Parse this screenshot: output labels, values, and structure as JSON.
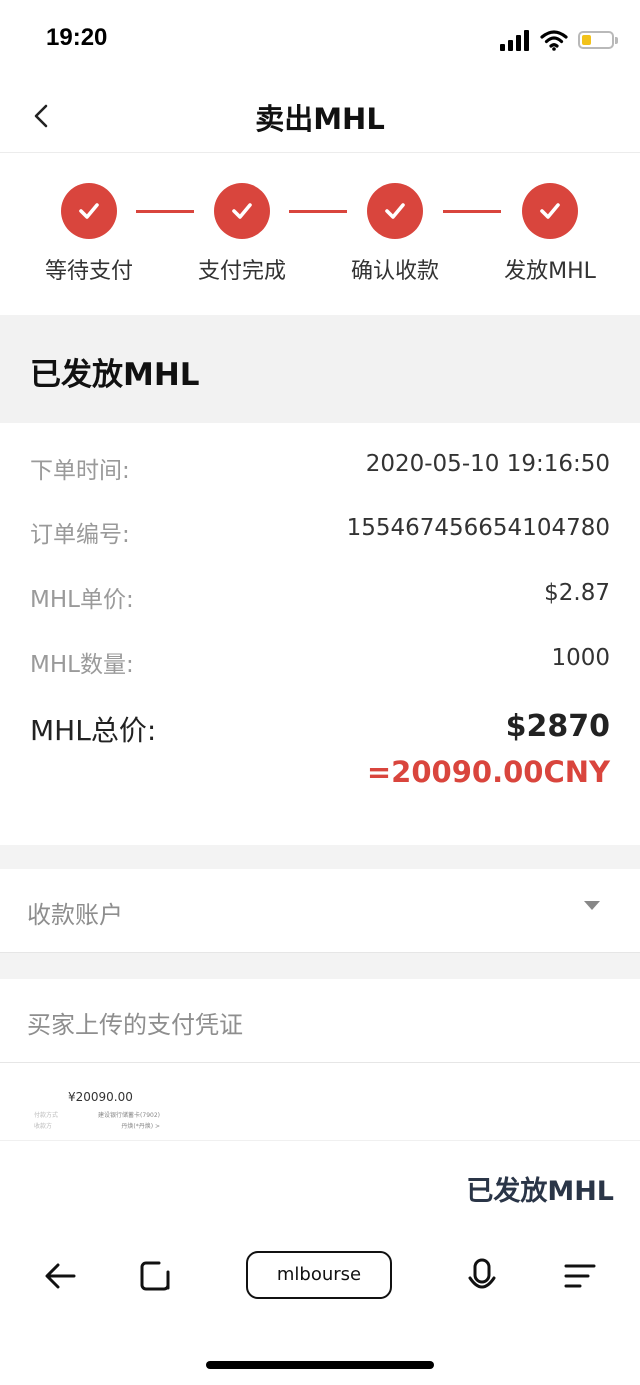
{
  "status_bar": {
    "time": "19:20",
    "battery_color": "#f2c21a"
  },
  "nav": {
    "title": "卖出MHL",
    "back_icon": "chevron-left-icon"
  },
  "steps": [
    {
      "label": "等待支付",
      "done": true
    },
    {
      "label": "支付完成",
      "done": true
    },
    {
      "label": "确认收款",
      "done": true
    },
    {
      "label": "发放MHL",
      "done": true
    }
  ],
  "status_title": "已发放MHL",
  "details": {
    "order_time": {
      "label": "下单时间:",
      "value": "2020-05-10 19:16:50"
    },
    "order_no": {
      "label": "订单编号:",
      "value": "155467456654104780"
    },
    "unit_price": {
      "label": "MHL单价:",
      "value": "$2.87"
    },
    "quantity": {
      "label": "MHL数量:",
      "value": "1000"
    },
    "total": {
      "label": "MHL总价:",
      "value": "$2870"
    },
    "total_cny": "=20090.00CNY"
  },
  "account": {
    "label": "收款账户"
  },
  "voucher": {
    "label": "买家上传的支付凭证",
    "thumb_amount": "¥20090.00",
    "thumb_row1_left": "付款方式",
    "thumb_row1_right": "建设银行储蓄卡(7902)",
    "thumb_row2_left": "收款方",
    "thumb_row2_right": "丹焕(*丹焕) >"
  },
  "footer": {
    "issued_label": "已发放MHL"
  },
  "browser": {
    "url": "mlbourse"
  },
  "colors": {
    "accent": "#d9453d",
    "footer_text": "#2a3547"
  }
}
